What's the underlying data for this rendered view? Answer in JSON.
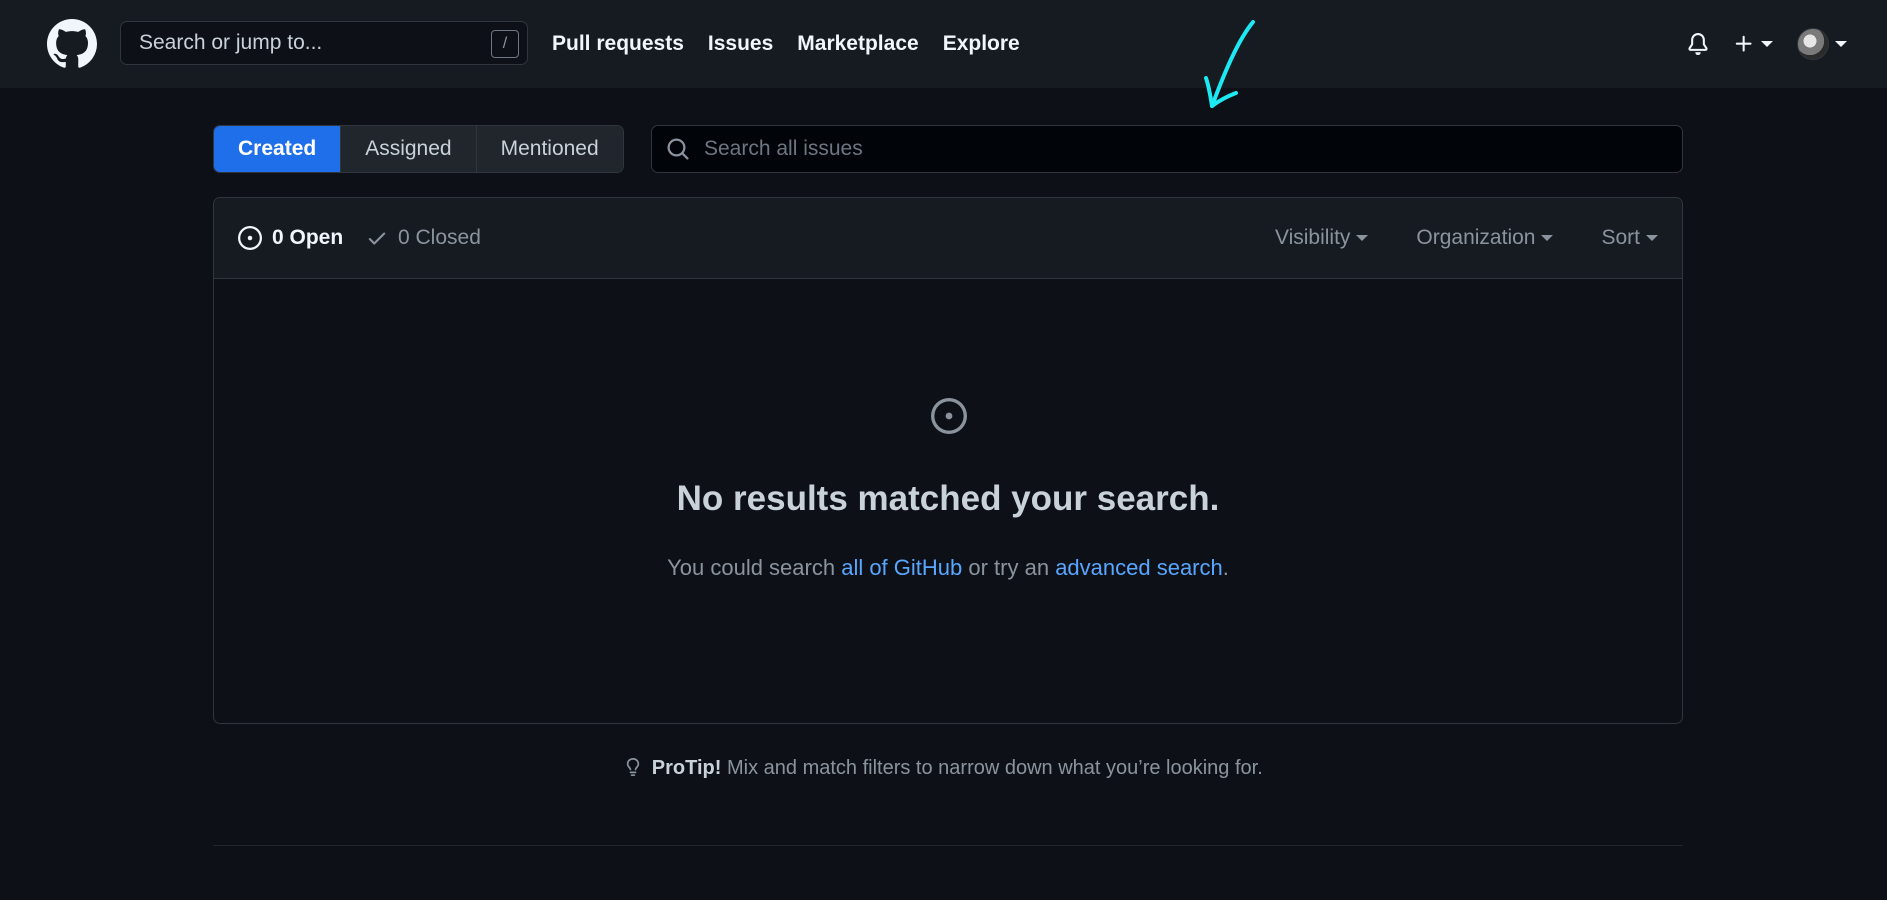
{
  "header": {
    "search_placeholder": "Search or jump to...",
    "search_shortcut": "/",
    "nav": [
      "Pull requests",
      "Issues",
      "Marketplace",
      "Explore"
    ],
    "notifications_icon": "bell-icon",
    "create_icon": "plus-icon",
    "avatar_icon": "user-avatar"
  },
  "tabs": [
    {
      "label": "Created",
      "active": true
    },
    {
      "label": "Assigned",
      "active": false
    },
    {
      "label": "Mentioned",
      "active": false
    }
  ],
  "issue_search": {
    "placeholder": "Search all issues"
  },
  "states": {
    "open_label": "0 Open",
    "closed_label": "0 Closed"
  },
  "filters": [
    "Visibility",
    "Organization",
    "Sort"
  ],
  "blankslate": {
    "title": "No results matched your search.",
    "text_prefix": "You could search ",
    "link_all": "all of GitHub",
    "text_middle": " or try an ",
    "link_advanced": "advanced search",
    "text_suffix": "."
  },
  "protip": {
    "label": "ProTip!",
    "text": " Mix and match filters to narrow down what you’re looking for."
  },
  "colors": {
    "background": "#0d1117",
    "header": "#161b22",
    "accent": "#1f6feb",
    "link": "#58a6ff",
    "annotation": "#1de9f5"
  }
}
